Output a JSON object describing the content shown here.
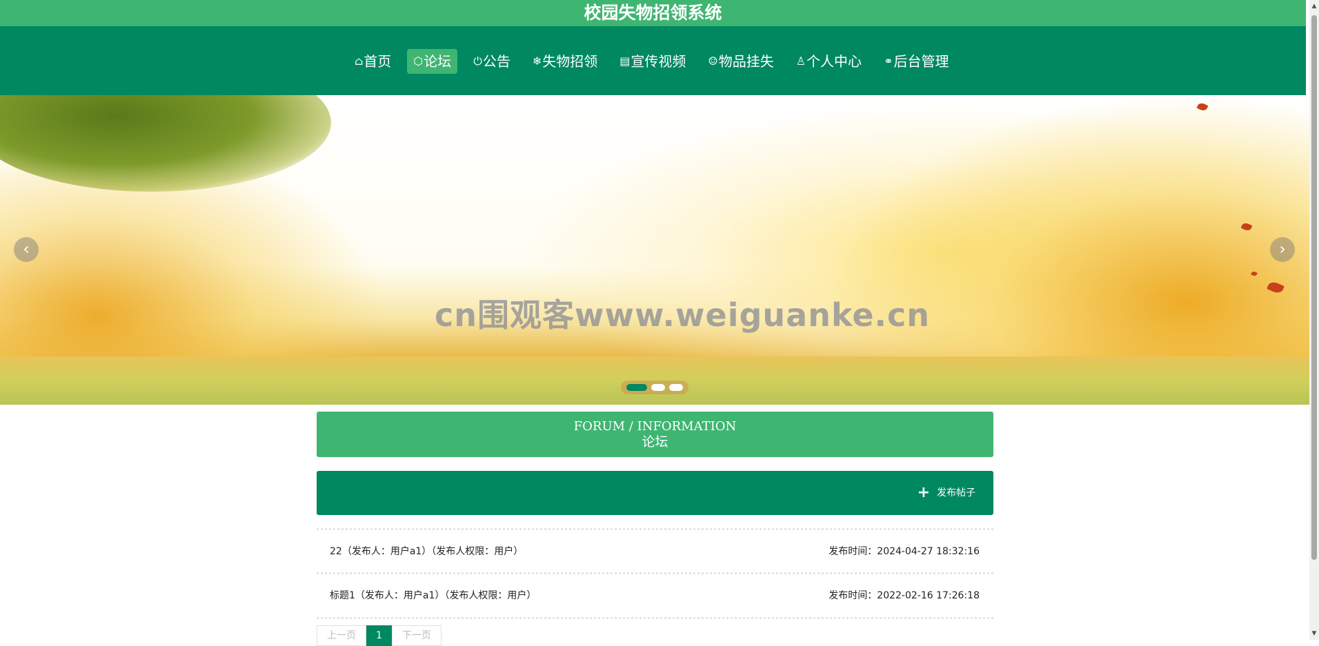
{
  "site": {
    "title": "校园失物招领系统"
  },
  "nav": {
    "items": [
      {
        "icon": "⌂",
        "label": "首页",
        "active": false
      },
      {
        "icon": "⬡",
        "label": "论坛",
        "active": true
      },
      {
        "icon": "⏻",
        "label": "公告",
        "active": false
      },
      {
        "icon": "❄",
        "label": "失物招领",
        "active": false
      },
      {
        "icon": "▤",
        "label": "宣传视频",
        "active": false
      },
      {
        "icon": "☺",
        "label": "物品挂失",
        "active": false
      },
      {
        "icon": "♙",
        "label": "个人中心",
        "active": false
      },
      {
        "icon": "⚭",
        "label": "后台管理",
        "active": false
      }
    ]
  },
  "banner": {
    "watermark": "cn围观客www.weiguanke.cn",
    "prev_arrow": "‹",
    "next_arrow": "›",
    "slide_count": 3,
    "active_slide": 1
  },
  "section": {
    "title_en": "FORUM / INFORMATION",
    "title_cn": "论坛"
  },
  "actions": {
    "post_icon": "+",
    "post_label": "发布帖子"
  },
  "posts": [
    {
      "title": "22（发布人：用户a1）（发布人权限：用户）",
      "time": "发布时间：2024-04-27 18:32:16"
    },
    {
      "title": "标题1（发布人：用户a1）（发布人权限：用户）",
      "time": "发布时间：2022-02-16 17:26:18"
    }
  ],
  "pagination": {
    "prev": "上一页",
    "current": "1",
    "next": "下一页"
  },
  "colors": {
    "primary": "#008861",
    "accent": "#3fb572"
  }
}
